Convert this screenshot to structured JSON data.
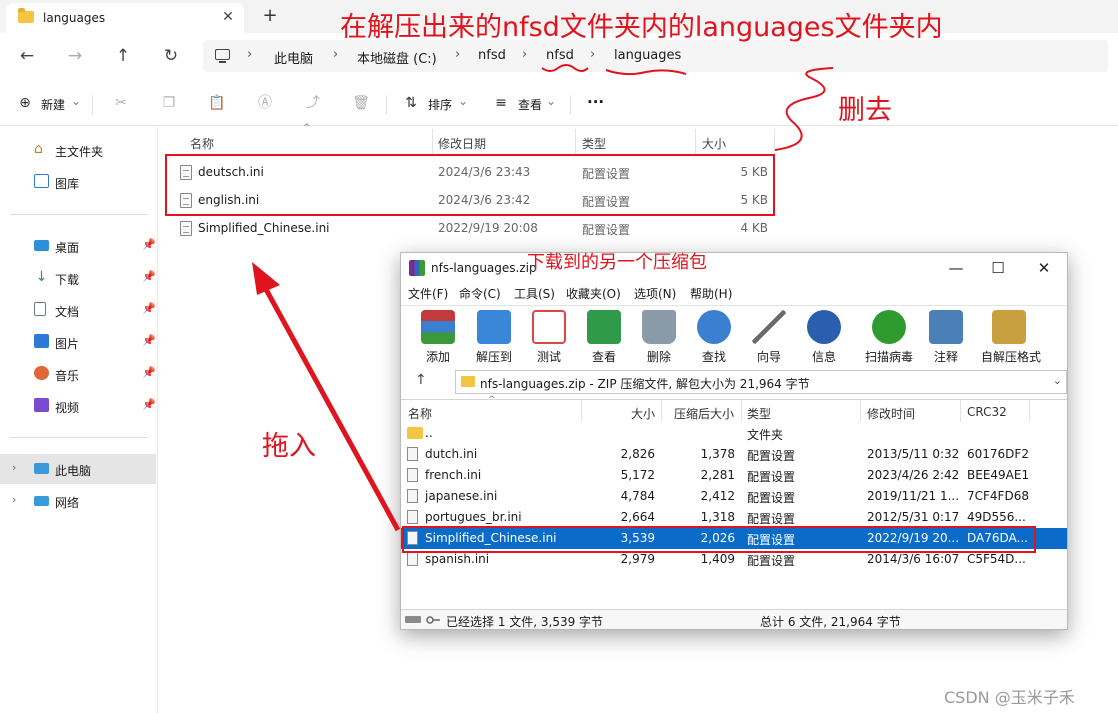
{
  "explorer": {
    "tab_title": "languages",
    "tab_close": "✕",
    "new_tab": "+",
    "nav": {
      "back": "←",
      "forward": "→",
      "up": "↑",
      "refresh": "↻"
    },
    "breadcrumbs": [
      "此电脑",
      "本地磁盘 (C:)",
      "nfsd",
      "nfsd",
      "languages"
    ],
    "breadcrumb_sep": "›",
    "commands": {
      "new_label": "新建",
      "new_chevron": "⌄",
      "sort_label": "排序",
      "view_label": "查看",
      "more_label": "···"
    },
    "sidebar": {
      "quick": [
        {
          "label": "主文件夹",
          "icon": "home-icon"
        },
        {
          "label": "图库",
          "icon": "gallery-icon"
        }
      ],
      "pinned": [
        {
          "label": "桌面",
          "icon": "desktop-icon",
          "color": "#2d8fd8"
        },
        {
          "label": "下载",
          "icon": "download-icon",
          "color": "#1f9b59"
        },
        {
          "label": "文档",
          "icon": "document-icon",
          "color": "#6b7b8c"
        },
        {
          "label": "图片",
          "icon": "pictures-icon",
          "color": "#2c7ad6"
        },
        {
          "label": "音乐",
          "icon": "music-icon",
          "color": "#e0653a"
        },
        {
          "label": "视频",
          "icon": "video-icon",
          "color": "#7a4bd0"
        }
      ],
      "pin_glyph": "📌",
      "tree": [
        {
          "label": "此电脑",
          "icon": "this-pc-icon",
          "selected": true
        },
        {
          "label": "网络",
          "icon": "network-icon",
          "selected": false
        }
      ],
      "chevron": "›"
    },
    "columns": {
      "name": "名称",
      "date": "修改日期",
      "type": "类型",
      "size": "大小"
    },
    "files": [
      {
        "name": "deutsch.ini",
        "date": "2024/3/6 23:43",
        "type": "配置设置",
        "size": "5 KB"
      },
      {
        "name": "english.ini",
        "date": "2024/3/6 23:42",
        "type": "配置设置",
        "size": "5 KB"
      },
      {
        "name": "Simplified_Chinese.ini",
        "date": "2022/9/19 20:08",
        "type": "配置设置",
        "size": "4 KB"
      }
    ]
  },
  "annotations": {
    "heading": "在解压出来的nfsd文件夹内的languages文件夹内",
    "delete_note": "删去",
    "zip_note": "下载到的另一个压缩包",
    "drag_note": "拖入",
    "color": "#e0141e"
  },
  "rar": {
    "title": "nfs-languages.zip",
    "win_buttons": {
      "minimize": "—",
      "maximize": "☐",
      "close": "✕"
    },
    "menus": [
      "文件(F)",
      "命令(C)",
      "工具(S)",
      "收藏夹(O)",
      "选项(N)",
      "帮助(H)"
    ],
    "tools": [
      {
        "label": "添加",
        "icon": "add-archive-icon",
        "color": "#c23a3a"
      },
      {
        "label": "解压到",
        "icon": "extract-to-icon",
        "color": "#3a86d8"
      },
      {
        "label": "测试",
        "icon": "test-icon",
        "color": "#d94848"
      },
      {
        "label": "查看",
        "icon": "view-book-icon",
        "color": "#2f9a4a"
      },
      {
        "label": "删除",
        "icon": "delete-bin-icon",
        "color": "#8a9aa8"
      },
      {
        "label": "查找",
        "icon": "find-icon",
        "color": "#3a7fd0"
      },
      {
        "label": "向导",
        "icon": "wizard-icon",
        "color": "#6a6a6a"
      },
      {
        "label": "信息",
        "icon": "info-icon",
        "color": "#2a5fb0"
      },
      {
        "label": "扫描病毒",
        "icon": "virus-scan-icon",
        "color": "#2f9a2f"
      },
      {
        "label": "注释",
        "icon": "comment-icon",
        "color": "#4b7fb8"
      },
      {
        "label": "自解压格式",
        "icon": "sfx-icon",
        "color": "#c8a040"
      }
    ],
    "up_glyph": "↑",
    "address": "nfs-languages.zip - ZIP 压缩文件, 解包大小为 21,964 字节",
    "address_drop": "⌄",
    "columns": {
      "name": "名称",
      "size": "大小",
      "packed": "压缩后大小",
      "type": "类型",
      "modified": "修改时间",
      "crc": "CRC32"
    },
    "rows": [
      {
        "name": "..",
        "size": "",
        "packed": "",
        "type": "文件夹",
        "modified": "",
        "crc": "",
        "folder": true,
        "selected": false
      },
      {
        "name": "dutch.ini",
        "size": "2,826",
        "packed": "1,378",
        "type": "配置设置",
        "modified": "2013/5/11 0:32",
        "crc": "60176DF2",
        "folder": false,
        "selected": false
      },
      {
        "name": "french.ini",
        "size": "5,172",
        "packed": "2,281",
        "type": "配置设置",
        "modified": "2023/4/26 2:42",
        "crc": "BEE49AE1",
        "folder": false,
        "selected": false
      },
      {
        "name": "japanese.ini",
        "size": "4,784",
        "packed": "2,412",
        "type": "配置设置",
        "modified": "2019/11/21 1...",
        "crc": "7CF4FD68",
        "folder": false,
        "selected": false
      },
      {
        "name": "portugues_br.ini",
        "size": "2,664",
        "packed": "1,318",
        "type": "配置设置",
        "modified": "2012/5/31 0:17",
        "crc": "49D556...",
        "folder": false,
        "selected": false
      },
      {
        "name": "Simplified_Chinese.ini",
        "size": "3,539",
        "packed": "2,026",
        "type": "配置设置",
        "modified": "2022/9/19 20...",
        "crc": "DA76DA...",
        "folder": false,
        "selected": true
      },
      {
        "name": "spanish.ini",
        "size": "2,979",
        "packed": "1,409",
        "type": "配置设置",
        "modified": "2014/3/6 16:07",
        "crc": "C5F54D...",
        "folder": false,
        "selected": false
      }
    ],
    "status_left": "已经选择 1 文件, 3,539 字节",
    "status_right": "总计 6 文件, 21,964 字节"
  },
  "watermark": "CSDN @玉米子禾"
}
